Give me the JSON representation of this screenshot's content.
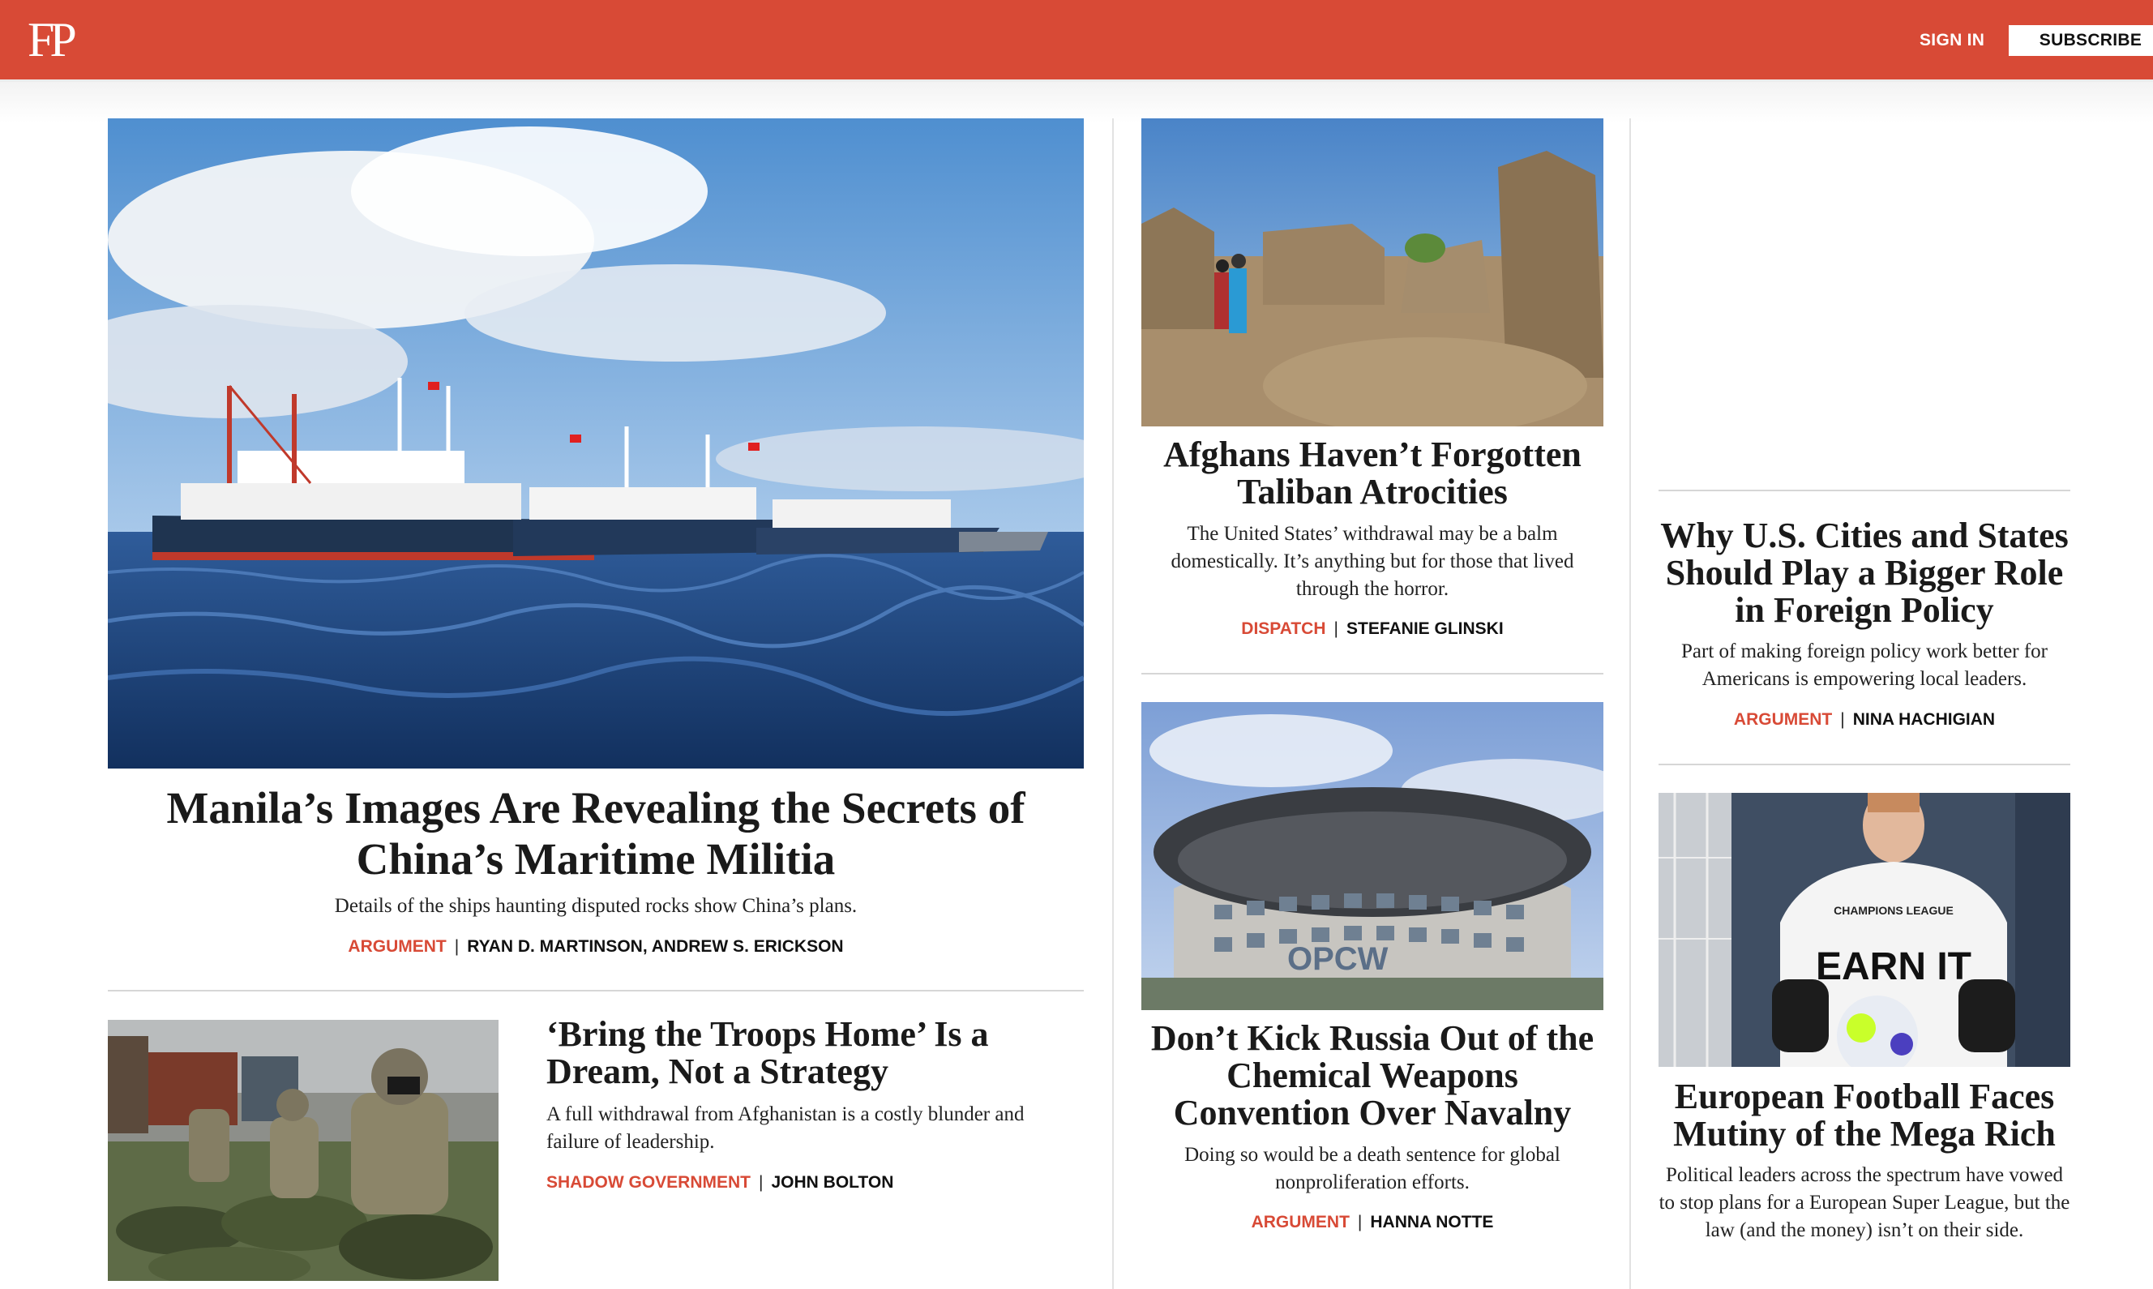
{
  "header": {
    "logo": "FP",
    "sign_in": "SIGN IN",
    "subscribe": "SUBSCRIBE",
    "brand_color": "#d84a36"
  },
  "articles": [
    {
      "headline": "Manila’s Images Are Revealing the Secrets of China’s Maritime Militia",
      "dek": "Details of the ships haunting disputed rocks show China’s plans.",
      "category": "ARGUMENT",
      "authors": "RYAN D. MARTINSON, ANDREW S. ERICKSON"
    },
    {
      "headline": "‘Bring the Troops Home’ Is a Dream, Not a Strategy",
      "dek": "A full withdrawal from Afghanistan is a costly blunder and failure of leadership.",
      "category": "SHADOW GOVERNMENT",
      "authors": "JOHN BOLTON"
    },
    {
      "headline": "Afghans Haven’t Forgotten Taliban Atrocities",
      "dek": "The United States’ withdrawal may be a balm domestically. It’s anything but for those that lived through the horror.",
      "category": "DISPATCH",
      "authors": "STEFANIE GLINSKI"
    },
    {
      "headline": "Don’t Kick Russia Out of the Chemical Weapons Convention Over Navalny",
      "dek": "Doing so would be a death sentence for global nonproliferation efforts.",
      "category": "ARGUMENT",
      "authors": "HANNA NOTTE"
    },
    {
      "headline": "Why U.S. Cities and States Should Play a Bigger Role in Foreign Policy",
      "dek": "Part of making foreign policy work better for Americans is empowering local leaders.",
      "category": "ARGUMENT",
      "authors": "NINA HACHIGIAN"
    },
    {
      "headline": "European Football Faces Mutiny of the Mega Rich",
      "dek": "Political leaders across the spectrum have vowed to stop plans for a European Super League, but the law (and the money) isn’t on their side.",
      "category": "",
      "authors": ""
    }
  ],
  "image_text": {
    "opcw_sign": "OPCW",
    "shirt_line1": "CHAMPIONS LEAGUE",
    "shirt_line2": "EARN IT"
  }
}
